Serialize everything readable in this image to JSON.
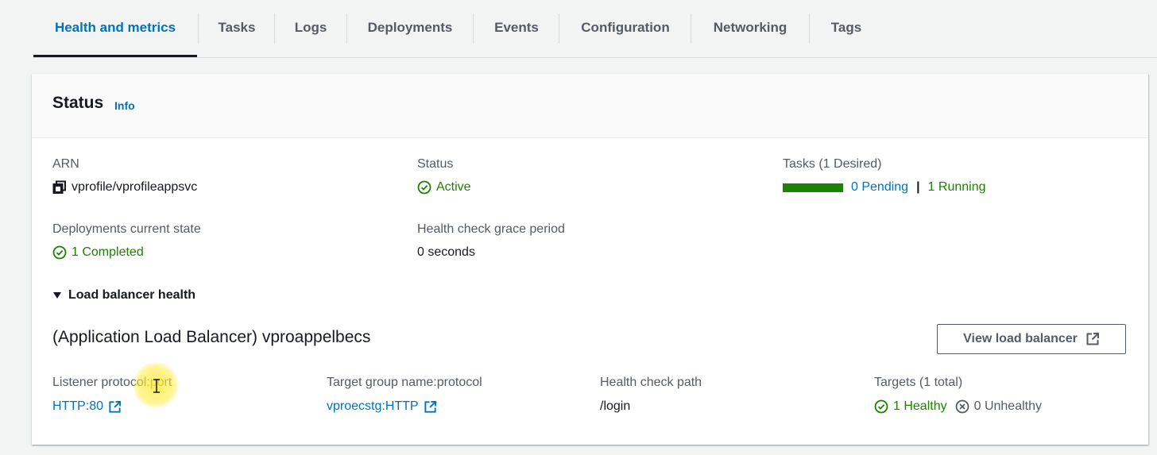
{
  "tabs": [
    {
      "label": "Health and metrics",
      "active": true
    },
    {
      "label": "Tasks"
    },
    {
      "label": "Logs"
    },
    {
      "label": "Deployments"
    },
    {
      "label": "Events"
    },
    {
      "label": "Configuration"
    },
    {
      "label": "Networking"
    },
    {
      "label": "Tags"
    }
  ],
  "status_panel": {
    "title": "Status",
    "info": "Info",
    "arn_label": "ARN",
    "arn_value": "vprofile/vprofileappsvc",
    "status_label": "Status",
    "status_value": "Active",
    "tasks_label": "Tasks (1 Desired)",
    "tasks_pending": "0 Pending",
    "tasks_sep": "|",
    "tasks_running": "1 Running",
    "tasks_running_fraction": 1.0,
    "deploy_label": "Deployments current state",
    "deploy_value": "1 Completed",
    "grace_label": "Health check grace period",
    "grace_value": "0 seconds"
  },
  "lb_health": {
    "expander_label": "Load balancer health",
    "title": "(Application Load Balancer) vproappelbecs",
    "view_button": "View load balancer",
    "listener_label": "Listener protocol:port",
    "listener_value": "HTTP:80",
    "tg_label": "Target group name:protocol",
    "tg_value": "vproecstg:HTTP",
    "hc_path_label": "Health check path",
    "hc_path_value": "/login",
    "targets_label": "Targets (1 total)",
    "healthy": "1 Healthy",
    "unhealthy": "0 Unhealthy"
  },
  "colors": {
    "accent": "#0073bb",
    "success": "#1d8102",
    "text": "#16191f",
    "muted": "#545b64"
  }
}
